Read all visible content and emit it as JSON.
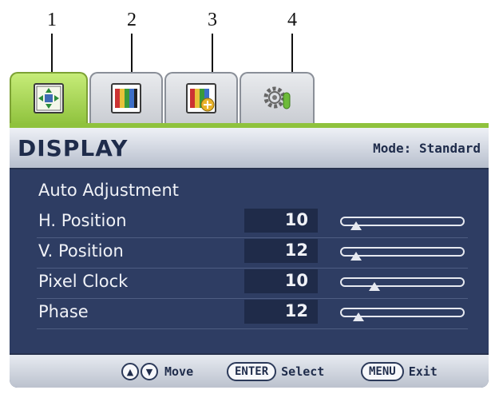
{
  "callouts": [
    "1",
    "2",
    "3",
    "4"
  ],
  "tabs": [
    {
      "icon": "picture-position-icon",
      "active": true
    },
    {
      "icon": "color-bars-icon",
      "active": false
    },
    {
      "icon": "color-bars-plus-icon",
      "active": false
    },
    {
      "icon": "gear-settings-icon",
      "active": false
    }
  ],
  "header": {
    "title": "DISPLAY",
    "mode": "Mode: Standard"
  },
  "menu": {
    "auto_adjustment": "Auto Adjustment",
    "items": [
      {
        "label": "H. Position",
        "value": "10",
        "level": 0.12
      },
      {
        "label": "V. Position",
        "value": "12",
        "level": 0.12
      },
      {
        "label": "Pixel Clock",
        "value": "10",
        "level": 0.27
      },
      {
        "label": "Phase",
        "value": "12",
        "level": 0.14
      }
    ]
  },
  "footer": {
    "up_symbol": "▲",
    "down_symbol": "▼",
    "move_label": "Move",
    "enter_key": "ENTER",
    "select_label": "Select",
    "menu_key": "MENU",
    "exit_label": "Exit"
  },
  "colors": {
    "active_tab": "#8fc23d",
    "panel_bg": "#2e3d63",
    "header_text": "#1f2c4b"
  }
}
